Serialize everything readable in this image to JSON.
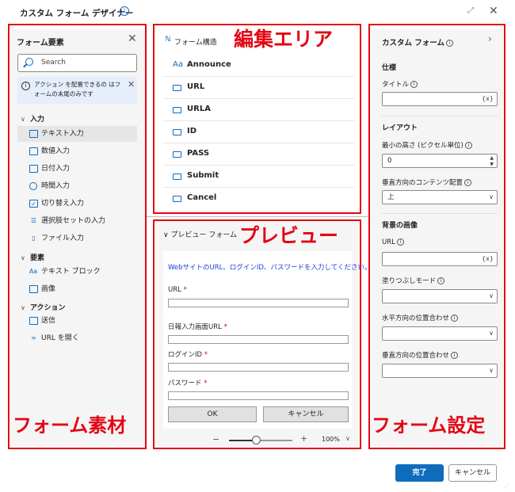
{
  "window": {
    "title": "カスタム フォーム デザイナー"
  },
  "left": {
    "title": "フォーム要素",
    "search_placeholder": "Search",
    "notice": "アクション を配置できるの はフォームの末尾のみです",
    "groups": [
      {
        "label": "入力",
        "items": [
          "テキスト入力",
          "数値入力",
          "日付入力",
          "時間入力",
          "切り替え入力",
          "選択肢セットの入力",
          "ファイル入力"
        ]
      },
      {
        "label": "要素",
        "items": [
          "テキスト ブロック",
          "画像"
        ]
      },
      {
        "label": "アクション",
        "items": [
          "送信",
          "URL を開く"
        ]
      }
    ]
  },
  "middle": {
    "title": "フォーム構造",
    "rows": [
      "Announce",
      "URL",
      "URLA",
      "ID",
      "PASS",
      "Submit",
      "Cancel"
    ]
  },
  "preview": {
    "title": "プレビュー フォーム",
    "description": "WebサイトのURL、ログインID、パスワードを入力してください。",
    "fields": [
      "URL",
      "日報入力画面URL",
      "ログインID",
      "パスワード"
    ],
    "ok": "OK",
    "cancel": "キャンセル",
    "zoom": "100%"
  },
  "right": {
    "title": "カスタム フォーム",
    "sections": {
      "spec": "仕様",
      "title_label": "タイトル",
      "expr": "{x}",
      "layout": "レイアウト",
      "min_height": "最小の高さ (ピクセル単位)",
      "min_height_value": "0",
      "vertical_align": "垂直方向のコンテンツ配置",
      "vertical_align_value": "上",
      "bg": "背景の画像",
      "url": "URL",
      "fill_mode": "塗りつぶしモード",
      "h_align": "水平方向の位置合わせ",
      "v_align": "垂直方向の位置合わせ"
    }
  },
  "footer": {
    "done": "完了",
    "cancel": "キャンセル"
  },
  "annotations": {
    "edit": "編集エリア",
    "preview": "プレビュー",
    "elements": "フォーム素材",
    "settings": "フォーム設定"
  },
  "colors": {
    "accent": "#0f6cbd",
    "annotation": "#e30613"
  }
}
